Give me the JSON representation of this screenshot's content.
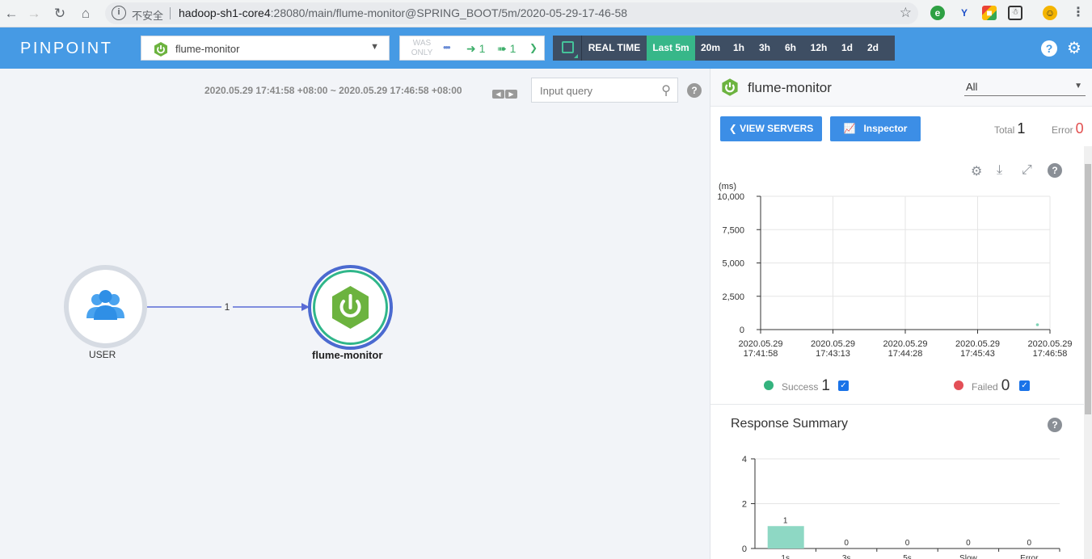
{
  "browser": {
    "insecure_label": "不安全",
    "url_host": "hadoop-sh1-core4",
    "url_rest": ":28080/main/flume-monitor@SPRING_BOOT/5m/2020-05-29-17-46-58"
  },
  "header": {
    "logo": "PINPOINT",
    "app_selector": "flume-monitor",
    "was_only": "WAS ONLY",
    "inbound_count": "1",
    "outbound_count": "1",
    "realtime_label": "REAL TIME",
    "periods": [
      "Last 5m",
      "20m",
      "1h",
      "3h",
      "6h",
      "12h",
      "1d",
      "2d"
    ],
    "active_period": "Last 5m"
  },
  "map": {
    "time_range": "2020.05.29 17:41:58 +08:00 ~ 2020.05.29 17:46:58 +08:00",
    "query_placeholder": "Input query",
    "nodes": {
      "user_label": "USER",
      "app_label": "flume-monitor"
    },
    "edge_count": "1"
  },
  "panel": {
    "title": "flume-monitor",
    "agent_select": "All",
    "view_servers": "VIEW SERVERS",
    "inspector": "Inspector",
    "total_label": "Total",
    "total_value": "1",
    "error_label": "Error",
    "error_value": "0",
    "success_label": "Success",
    "success_value": "1",
    "failed_label": "Failed",
    "failed_value": "0",
    "response_summary": "Response Summary"
  },
  "colors": {
    "brand_blue": "#469ae4",
    "success": "#34b37e",
    "failed": "#e34f57",
    "bar": "#8ed8c4"
  },
  "chart_data": [
    {
      "type": "scatter",
      "ylabel": "(ms)",
      "ylim": [
        0,
        10000
      ],
      "y_ticks": [
        "10,000",
        "7,500",
        "5,000",
        "2,500",
        "0"
      ],
      "x_ticks": [
        [
          "2020.05.29",
          "17:41:58"
        ],
        [
          "2020.05.29",
          "17:43:13"
        ],
        [
          "2020.05.29",
          "17:44:28"
        ],
        [
          "2020.05.29",
          "17:45:43"
        ],
        [
          "2020.05.29",
          "17:46:58"
        ]
      ],
      "points": [
        {
          "x": "17:46:45",
          "y": 60,
          "series": "Success"
        }
      ],
      "grid": true
    },
    {
      "type": "bar",
      "title": "Response Summary",
      "categories": [
        "1s",
        "3s",
        "5s",
        "Slow",
        "Error"
      ],
      "values": [
        1,
        0,
        0,
        0,
        0
      ],
      "y_ticks": [
        "4",
        "2",
        "0"
      ],
      "ylim": [
        0,
        4
      ]
    }
  ]
}
